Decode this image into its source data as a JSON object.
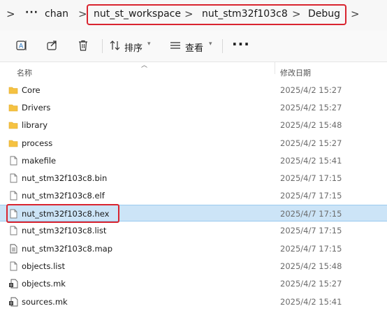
{
  "breadcrumb": {
    "nav_chevron": ">",
    "ellipsis": "···",
    "items": [
      "chan",
      "nut_st_workspace",
      "nut_stm32f103c8",
      "Debug"
    ],
    "separator": ">"
  },
  "toolbar": {
    "sort_label": "排序",
    "view_label": "查看",
    "more_label": "···"
  },
  "columns": {
    "name": "名称",
    "modified": "修改日期"
  },
  "files": [
    {
      "name": "Core",
      "date": "2025/4/2 15:27",
      "type": "folder"
    },
    {
      "name": "Drivers",
      "date": "2025/4/2 15:27",
      "type": "folder"
    },
    {
      "name": "library",
      "date": "2025/4/2 15:48",
      "type": "folder"
    },
    {
      "name": "process",
      "date": "2025/4/2 15:27",
      "type": "folder"
    },
    {
      "name": "makefile",
      "date": "2025/4/2 15:41",
      "type": "file"
    },
    {
      "name": "nut_stm32f103c8.bin",
      "date": "2025/4/7 17:15",
      "type": "file"
    },
    {
      "name": "nut_stm32f103c8.elf",
      "date": "2025/4/7 17:15",
      "type": "file"
    },
    {
      "name": "nut_stm32f103c8.hex",
      "date": "2025/4/7 17:15",
      "type": "file",
      "selected": true
    },
    {
      "name": "nut_stm32f103c8.list",
      "date": "2025/4/7 17:15",
      "type": "file"
    },
    {
      "name": "nut_stm32f103c8.map",
      "date": "2025/4/7 17:15",
      "type": "textfile"
    },
    {
      "name": "objects.list",
      "date": "2025/4/2 15:48",
      "type": "file"
    },
    {
      "name": "objects.mk",
      "date": "2025/4/2 15:27",
      "type": "makefile"
    },
    {
      "name": "sources.mk",
      "date": "2025/4/2 15:41",
      "type": "makefile"
    }
  ],
  "colors": {
    "highlight": "#d9242f",
    "selected_bg": "#cce4f7",
    "folder": "#f5c242"
  }
}
